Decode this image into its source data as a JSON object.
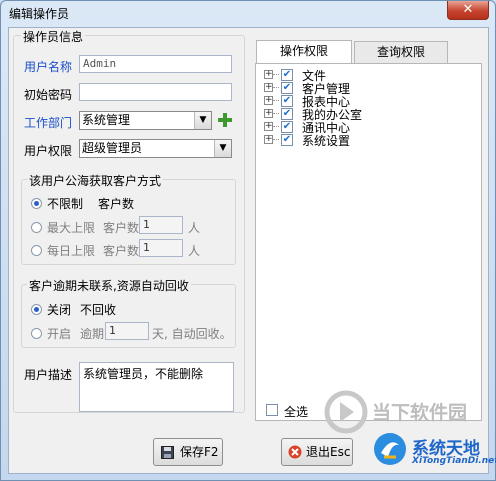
{
  "window": {
    "title": "编辑操作员",
    "close_glyph": "✕"
  },
  "left": {
    "group_title": "操作员信息",
    "username_label": "用户名称",
    "username_value": "Admin",
    "password_label": "初始密码",
    "password_value": "",
    "dept_label": "工作部门",
    "dept_value": "系统管理",
    "perm_label": "用户权限",
    "perm_value": "超级管理员",
    "pool_group_title": "该用户公海获取客户方式",
    "pool_unlimited_label": "不限制",
    "pool_unlimited_suffix": "客户数",
    "pool_max_label": "最大上限",
    "pool_max_count_label": "客户数",
    "pool_max_value": "1",
    "pool_max_unit": "人",
    "pool_daily_label": "每日上限",
    "pool_daily_count_label": "客户数",
    "pool_daily_value": "1",
    "pool_daily_unit": "人",
    "overdue_group_title": "客户逾期未联系,资源自动回收",
    "overdue_off_label": "关闭",
    "overdue_off_suffix": "不回收",
    "overdue_on_label": "开启",
    "overdue_period_label": "逾期",
    "overdue_days_value": "1",
    "overdue_days_suffix": "天, 自动回收。",
    "desc_label": "用户描述",
    "desc_value": "系统管理员，不能删除"
  },
  "right": {
    "tabs": [
      {
        "label": "操作权限"
      },
      {
        "label": "查询权限"
      }
    ],
    "tree": [
      {
        "label": "文件"
      },
      {
        "label": "客户管理"
      },
      {
        "label": "报表中心"
      },
      {
        "label": "我的办公室"
      },
      {
        "label": "通讯中心"
      },
      {
        "label": "系统设置"
      }
    ],
    "select_all_label": "全选"
  },
  "buttons": {
    "save_label": "保存F2",
    "exit_label": "退出Esc"
  },
  "watermark": {
    "top_text": "当下软件园",
    "brand": "系统天地",
    "url": "XiTongTianDi.net"
  },
  "colors": {
    "accent_blue": "#1a4fc7",
    "check_blue": "#1d6fd6"
  }
}
